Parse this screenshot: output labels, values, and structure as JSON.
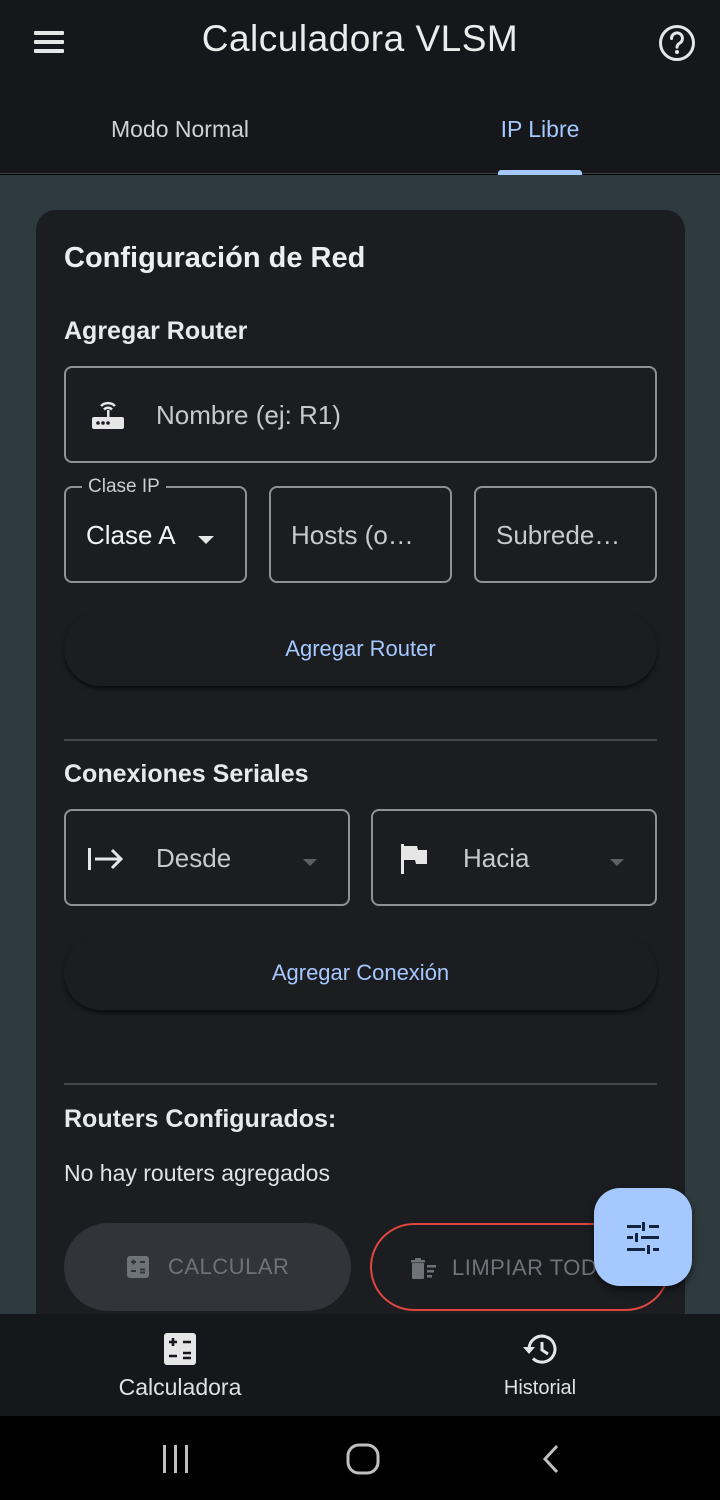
{
  "app": {
    "title": "Calculadora VLSM"
  },
  "tabs": [
    {
      "label": "Modo Normal",
      "active": false
    },
    {
      "label": "IP Libre",
      "active": true
    }
  ],
  "config": {
    "title": "Configuración de Red",
    "add_router": {
      "title": "Agregar Router",
      "name_placeholder": "Nombre (ej: R1)",
      "class_legend": "Clase IP",
      "class_value": "Clase A",
      "hosts_placeholder": "Hosts (o…",
      "subnets_placeholder": "Subrede…",
      "button": "Agregar Router"
    },
    "serial": {
      "title": "Conexiones Seriales",
      "from_label": "Desde",
      "to_label": "Hacia",
      "button": "Agregar Conexión"
    },
    "routers": {
      "title": "Routers Configurados:",
      "empty": "No hay routers agregados"
    },
    "actions": {
      "calculate": "CALCULAR",
      "clear": "LIMPIAR TODO"
    }
  },
  "bottom_nav": [
    {
      "label": "Calculadora",
      "active": true
    },
    {
      "label": "Historial",
      "active": false
    }
  ],
  "colors": {
    "accent": "#a5c8ff",
    "danger": "#e0463e",
    "background": "#2d3a3f",
    "surface": "#1b1d21"
  },
  "icons": [
    "menu-icon",
    "help-icon",
    "router-icon",
    "dropdown-arrow-icon",
    "arrow-right-to-line-icon",
    "flag-icon",
    "calculator-icon",
    "delete-sweep-icon",
    "tune-icon",
    "history-icon"
  ]
}
